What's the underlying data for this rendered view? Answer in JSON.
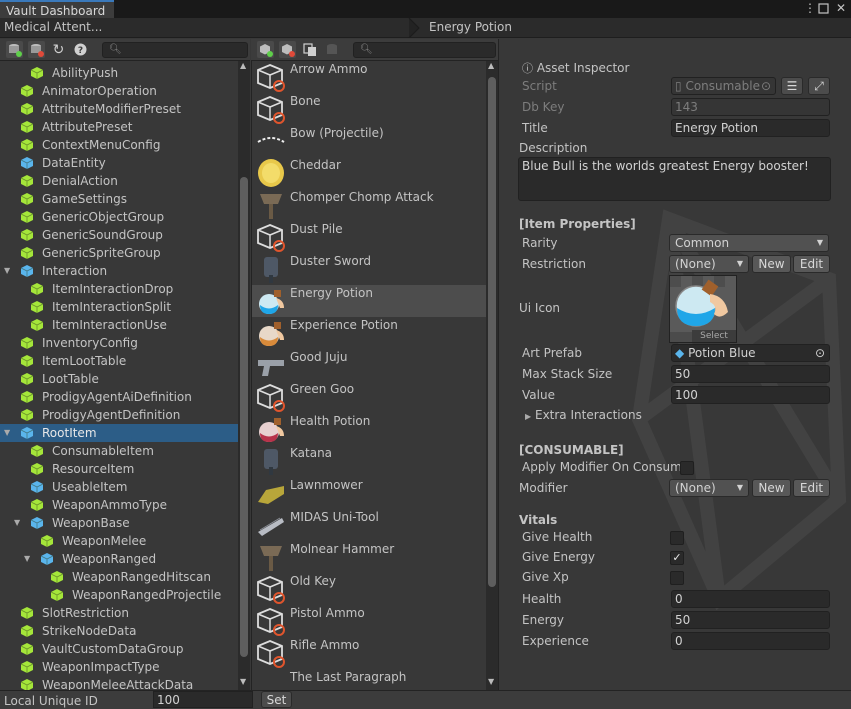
{
  "window": {
    "tab_title": "Vault Dashboard",
    "menu_icon": "kebab-menu-icon",
    "maximize_icon": "maximize-icon",
    "close_icon": "close-icon"
  },
  "header": {
    "breadcrumb": "Medical Attent...",
    "entity_title": "Energy Potion"
  },
  "tree_toolbar": {
    "search_placeholder": ""
  },
  "list_toolbar": {
    "search_placeholder": ""
  },
  "tree": {
    "items": [
      {
        "label": "AbilityPush",
        "indent": 1,
        "expanded": null,
        "kind": "item"
      },
      {
        "label": "AnimatorOperation",
        "indent": 0,
        "expanded": null,
        "kind": "item"
      },
      {
        "label": "AttributeModifierPreset",
        "indent": 0,
        "expanded": null,
        "kind": "item"
      },
      {
        "label": "AttributePreset",
        "indent": 0,
        "expanded": null,
        "kind": "item"
      },
      {
        "label": "ContextMenuConfig",
        "indent": 0,
        "expanded": null,
        "kind": "item"
      },
      {
        "label": "DataEntity",
        "indent": 0,
        "expanded": null,
        "kind": "base"
      },
      {
        "label": "DenialAction",
        "indent": 0,
        "expanded": null,
        "kind": "item"
      },
      {
        "label": "GameSettings",
        "indent": 0,
        "expanded": null,
        "kind": "item"
      },
      {
        "label": "GenericObjectGroup",
        "indent": 0,
        "expanded": null,
        "kind": "item"
      },
      {
        "label": "GenericSoundGroup",
        "indent": 0,
        "expanded": null,
        "kind": "item"
      },
      {
        "label": "GenericSpriteGroup",
        "indent": 0,
        "expanded": null,
        "kind": "item"
      },
      {
        "label": "Interaction",
        "indent": 0,
        "expanded": true,
        "kind": "base"
      },
      {
        "label": "ItemInteractionDrop",
        "indent": 1,
        "expanded": null,
        "kind": "item"
      },
      {
        "label": "ItemInteractionSplit",
        "indent": 1,
        "expanded": null,
        "kind": "item"
      },
      {
        "label": "ItemInteractionUse",
        "indent": 1,
        "expanded": null,
        "kind": "item"
      },
      {
        "label": "InventoryConfig",
        "indent": 0,
        "expanded": null,
        "kind": "item"
      },
      {
        "label": "ItemLootTable",
        "indent": 0,
        "expanded": null,
        "kind": "item"
      },
      {
        "label": "LootTable",
        "indent": 0,
        "expanded": null,
        "kind": "item"
      },
      {
        "label": "ProdigyAgentAiDefinition",
        "indent": 0,
        "expanded": null,
        "kind": "item"
      },
      {
        "label": "ProdigyAgentDefinition",
        "indent": 0,
        "expanded": null,
        "kind": "item"
      },
      {
        "label": "RootItem",
        "indent": 0,
        "expanded": true,
        "kind": "base",
        "selected": true
      },
      {
        "label": "ConsumableItem",
        "indent": 1,
        "expanded": null,
        "kind": "item"
      },
      {
        "label": "ResourceItem",
        "indent": 1,
        "expanded": null,
        "kind": "item"
      },
      {
        "label": "UseableItem",
        "indent": 1,
        "expanded": null,
        "kind": "base"
      },
      {
        "label": "WeaponAmmoType",
        "indent": 1,
        "expanded": null,
        "kind": "item"
      },
      {
        "label": "WeaponBase",
        "indent": 1,
        "expanded": true,
        "kind": "base"
      },
      {
        "label": "WeaponMelee",
        "indent": 2,
        "expanded": null,
        "kind": "item"
      },
      {
        "label": "WeaponRanged",
        "indent": 2,
        "expanded": true,
        "kind": "base"
      },
      {
        "label": "WeaponRangedHitscan",
        "indent": 3,
        "expanded": null,
        "kind": "item"
      },
      {
        "label": "WeaponRangedProjectile",
        "indent": 3,
        "expanded": null,
        "kind": "item"
      },
      {
        "label": "SlotRestriction",
        "indent": 0,
        "expanded": null,
        "kind": "item"
      },
      {
        "label": "StrikeNodeData",
        "indent": 0,
        "expanded": null,
        "kind": "item"
      },
      {
        "label": "VaultCustomDataGroup",
        "indent": 0,
        "expanded": null,
        "kind": "item"
      },
      {
        "label": "WeaponImpactType",
        "indent": 0,
        "expanded": null,
        "kind": "item"
      },
      {
        "label": "WeaponMeleeAttackData",
        "indent": 0,
        "expanded": null,
        "kind": "item"
      }
    ]
  },
  "list": {
    "items": [
      {
        "label": "Arrow Ammo",
        "icon": "missing-cube-icon"
      },
      {
        "label": "Bone",
        "icon": "missing-cube-icon"
      },
      {
        "label": "Bow (Projectile)",
        "icon": "bow-icon"
      },
      {
        "label": "Cheddar",
        "icon": "cheese-icon"
      },
      {
        "label": "Chomper Chomp Attack",
        "icon": "axe-icon"
      },
      {
        "label": "Dust Pile",
        "icon": "missing-cube-icon"
      },
      {
        "label": "Duster Sword",
        "icon": "sword-icon"
      },
      {
        "label": "Energy Potion",
        "icon": "potion-blue-icon",
        "selected": true
      },
      {
        "label": "Experience Potion",
        "icon": "potion-orange-icon"
      },
      {
        "label": "Good Juju",
        "icon": "gun-icon"
      },
      {
        "label": "Green Goo",
        "icon": "missing-cube-icon"
      },
      {
        "label": "Health Potion",
        "icon": "potion-red-icon"
      },
      {
        "label": "Katana",
        "icon": "sword-icon"
      },
      {
        "label": "Lawnmower",
        "icon": "lawnmower-icon"
      },
      {
        "label": "MIDAS Uni-Tool",
        "icon": "tool-icon"
      },
      {
        "label": "Molnear Hammer",
        "icon": "axe-icon"
      },
      {
        "label": "Old Key",
        "icon": "missing-cube-icon"
      },
      {
        "label": "Pistol Ammo",
        "icon": "missing-cube-icon"
      },
      {
        "label": "Rifle Ammo",
        "icon": "missing-cube-icon"
      },
      {
        "label": "The Last Paragraph",
        "icon": "none"
      }
    ]
  },
  "inspector": {
    "asset_inspector": "Asset Inspector",
    "script_label": "Script",
    "script_value": "Consumable",
    "dbkey_label": "Db Key",
    "dbkey_value": "143",
    "title_label": "Title",
    "title_value": "Energy Potion",
    "description_label": "Description",
    "description_value": "Blue Bull is the worlds greatest Energy booster!",
    "item_props_header": "[Item Properties]",
    "rarity_label": "Rarity",
    "rarity_value": "Common",
    "restriction_label": "Restriction",
    "restriction_value": "(None)",
    "new_label": "New",
    "edit_label": "Edit",
    "ui_icon_label": "Ui Icon",
    "select_label": "Select",
    "art_prefab_label": "Art Prefab",
    "art_prefab_value": "Potion Blue",
    "max_stack_label": "Max Stack Size",
    "max_stack_value": "50",
    "value_label": "Value",
    "value_value": "100",
    "extra_interactions_label": "Extra Interactions",
    "consumable_header": "[CONSUMABLE]",
    "apply_modifier_label": "Apply Modifier On Consume",
    "apply_modifier_checked": false,
    "modifier_label": "Modifier",
    "modifier_value": "(None)",
    "vitals_header": "Vitals",
    "give_health_label": "Give Health",
    "give_health_checked": false,
    "give_energy_label": "Give Energy",
    "give_energy_checked": true,
    "give_xp_label": "Give Xp",
    "give_xp_checked": false,
    "health_label": "Health",
    "health_value": "0",
    "energy_label": "Energy",
    "energy_value": "50",
    "experience_label": "Experience",
    "experience_value": "0"
  },
  "bottom": {
    "uid_label": "Local Unique ID",
    "uid_value": "100",
    "set_label": "Set"
  },
  "colors": {
    "item_cube": "#a5e63a",
    "base_cube": "#5ab5ec",
    "selection": "#2c5d87",
    "missing": "#e0552d"
  }
}
